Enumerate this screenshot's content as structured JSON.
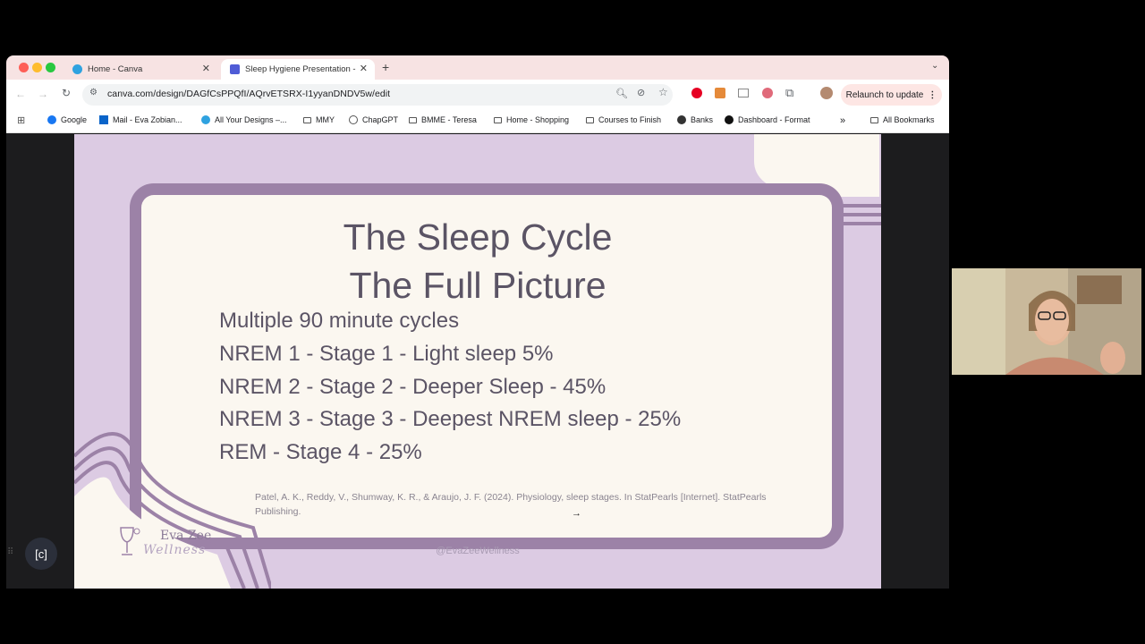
{
  "browser": {
    "tabs": [
      {
        "label": "Home - Canva",
        "active": false
      },
      {
        "label": "Sleep Hygiene Presentation -",
        "active": true
      }
    ],
    "new_tab_icon": "plus-icon",
    "url": "canva.com/design/DAGfCsPPQfI/AQrvETSRX-I1yyanDNDV5w/edit",
    "relaunch_label": "Relaunch to update",
    "bookmarks": [
      {
        "label": "Google",
        "icon": "facebook-icon"
      },
      {
        "label": "Mail - Eva Zobian...",
        "icon": "outlook-icon"
      },
      {
        "label": "All Your Designs –...",
        "icon": "canva-icon"
      },
      {
        "label": "MMY",
        "icon": "folder-icon"
      },
      {
        "label": "ChapGPT",
        "icon": "chatgpt-icon"
      },
      {
        "label": "BMME - Teresa",
        "icon": "folder-icon"
      },
      {
        "label": "Home - Shopping",
        "icon": "folder-icon"
      },
      {
        "label": "Courses to Finish",
        "icon": "folder-icon"
      },
      {
        "label": "Banks",
        "icon": "globe-icon"
      },
      {
        "label": "Dashboard - Format",
        "icon": "format-icon"
      }
    ],
    "more_bookmarks": "»",
    "all_bookmarks": "All Bookmarks"
  },
  "slide": {
    "title_line1": "The Sleep Cycle",
    "title_line2": "The Full Picture",
    "bullets": [
      "Multiple 90 minute cycles",
      "NREM 1 - Stage 1 - Light sleep 5%",
      "NREM 2 - Stage 2 - Deeper Sleep - 45%",
      "NREM 3 - Stage 3 - Deepest NREM sleep - 25%",
      "REM - Stage 4 - 25%"
    ],
    "citation": "Patel, A. K., Reddy, V., Shumway, K. R., & Araujo, J. F. (2024). Physiology, sleep stages. In StatPearls [Internet]. StatPearls Publishing.",
    "logo_line1": "Eva Zee",
    "logo_line2": "Wellness",
    "handle": "@EvaZeeWellness"
  },
  "colors": {
    "slide_bg": "#dccbe3",
    "frame": "#9c82a7",
    "card": "#fbf7f0",
    "text": "#5b5465"
  }
}
